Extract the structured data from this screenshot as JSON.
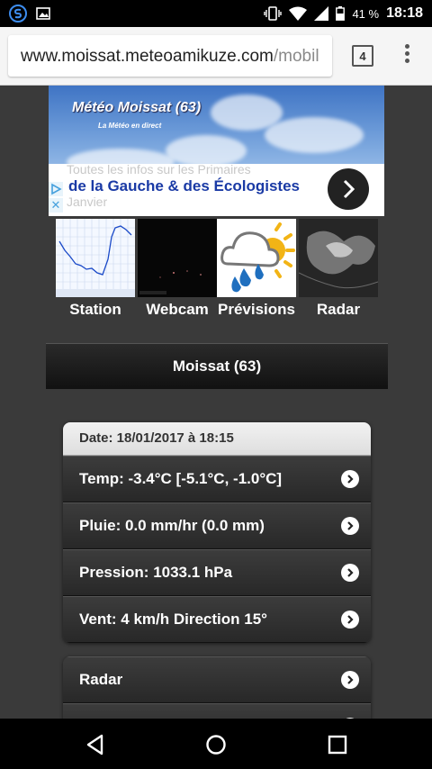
{
  "status_bar": {
    "battery_text": "41 %",
    "time": "18:18",
    "left_icons": [
      "app-s-icon",
      "image-icon"
    ],
    "right_icons": [
      "vibrate-icon",
      "wifi-icon",
      "signal-icon",
      "battery-icon"
    ]
  },
  "browser": {
    "url_host": "www.moissat.meteoamikuze.com",
    "url_path": "/mobil",
    "tab_count": "4"
  },
  "banner": {
    "title": "Météo Moissat (63)",
    "subtitle": "La Météo en direct"
  },
  "ad": {
    "ghost_line_1": "Toutes les infos sur les Primaires",
    "text": "de la Gauche & des Écologistes",
    "ghost_line_2": "Janvier"
  },
  "thumbnails": [
    {
      "label": "Station"
    },
    {
      "label": "Webcam"
    },
    {
      "label": "Prévisions"
    },
    {
      "label": "Radar"
    }
  ],
  "header": {
    "title": "Moissat (63)"
  },
  "readings": {
    "divider": "Date: 18/01/2017 à 18:15",
    "items": [
      {
        "label": "Temp: -3.4°C [-5.1°C, -1.0°C]"
      },
      {
        "label": "Pluie: 0.0 mm/hr (0.0 mm)"
      },
      {
        "label": "Pression: 1033.1 hPa"
      },
      {
        "label": "Vent: 4 km/h Direction 15°"
      }
    ]
  },
  "menu": {
    "items": [
      {
        "label": "Radar"
      }
    ]
  },
  "colors": {
    "page_bg": "#3a3a3a",
    "ad_text": "#1a3aa5",
    "status_bar": "#000000"
  }
}
